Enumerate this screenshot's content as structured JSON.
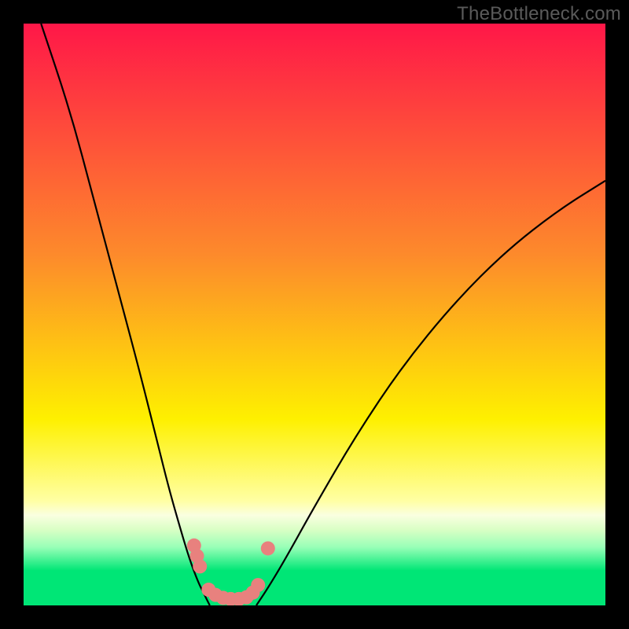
{
  "watermark": "TheBottleneck.com",
  "chart_data": {
    "type": "line",
    "title": "",
    "xlabel": "",
    "ylabel": "",
    "xlim": [
      0,
      100
    ],
    "ylim": [
      0,
      100
    ],
    "grid": false,
    "legend": false,
    "gradient_stops": [
      {
        "offset": 0.0,
        "color": "#ff1748"
      },
      {
        "offset": 0.4,
        "color": "#fd8b2b"
      },
      {
        "offset": 0.68,
        "color": "#fef000"
      },
      {
        "offset": 0.82,
        "color": "#ffffa3"
      },
      {
        "offset": 0.845,
        "color": "#faffe0"
      },
      {
        "offset": 0.87,
        "color": "#d9ffc5"
      },
      {
        "offset": 0.9,
        "color": "#98ffb7"
      },
      {
        "offset": 0.94,
        "color": "#00e676"
      },
      {
        "offset": 1.0,
        "color": "#00e676"
      }
    ],
    "series": [
      {
        "name": "left-curve",
        "x": [
          3,
          8,
          12,
          16,
          20,
          23,
          25,
          27,
          28.5,
          30,
          31,
          32
        ],
        "y": [
          100,
          85,
          70,
          55,
          40,
          28,
          20,
          13,
          8,
          4,
          2,
          0
        ]
      },
      {
        "name": "right-curve",
        "x": [
          40,
          42,
          45,
          50,
          57,
          65,
          74,
          83,
          92,
          100
        ],
        "y": [
          0,
          3,
          8,
          17,
          29,
          41,
          52,
          61,
          68,
          73
        ]
      }
    ],
    "markers": {
      "name": "bottleneck-band",
      "color": "#e8817e",
      "points": [
        {
          "x": 29.3,
          "y": 10.3
        },
        {
          "x": 29.8,
          "y": 8.5
        },
        {
          "x": 30.3,
          "y": 6.7
        },
        {
          "x": 31.8,
          "y": 2.7
        },
        {
          "x": 33.0,
          "y": 1.8
        },
        {
          "x": 34.3,
          "y": 1.3
        },
        {
          "x": 35.6,
          "y": 1.1
        },
        {
          "x": 37.0,
          "y": 1.1
        },
        {
          "x": 38.3,
          "y": 1.4
        },
        {
          "x": 39.4,
          "y": 2.2
        },
        {
          "x": 40.3,
          "y": 3.5
        },
        {
          "x": 42.0,
          "y": 9.8
        }
      ]
    }
  }
}
